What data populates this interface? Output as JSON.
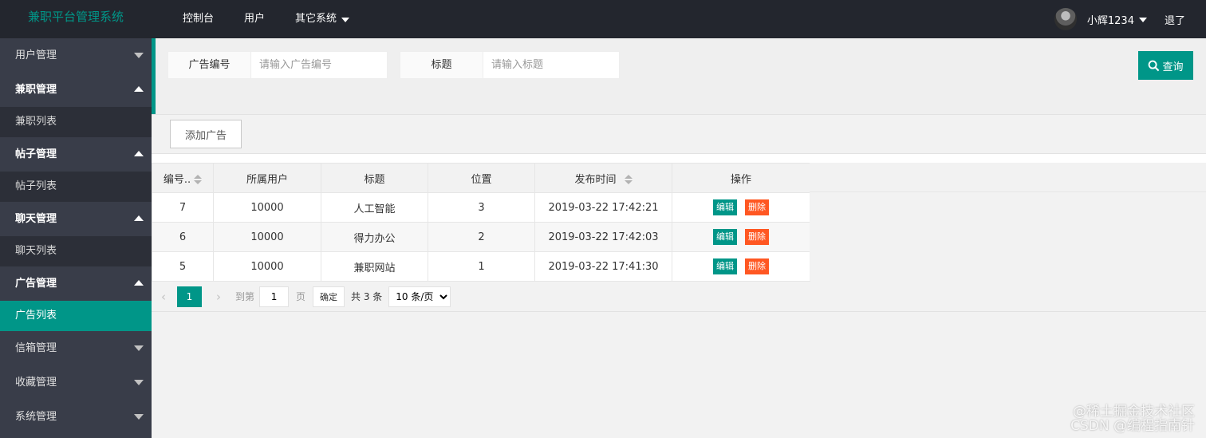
{
  "header": {
    "logo": "兼职平台管理系统",
    "nav": [
      {
        "label": "控制台"
      },
      {
        "label": "用户"
      },
      {
        "label": "其它系统"
      }
    ],
    "user_name": "小辉1234",
    "logout": "退了"
  },
  "sidebar": {
    "items": [
      {
        "label": "用户管理",
        "type": "group",
        "open": false
      },
      {
        "label": "兼职管理",
        "type": "group",
        "open": true
      },
      {
        "label": "兼职列表",
        "type": "sub",
        "active": false
      },
      {
        "label": "帖子管理",
        "type": "group",
        "open": true
      },
      {
        "label": "帖子列表",
        "type": "sub",
        "active": false
      },
      {
        "label": "聊天管理",
        "type": "group",
        "open": true
      },
      {
        "label": "聊天列表",
        "type": "sub",
        "active": false
      },
      {
        "label": "广告管理",
        "type": "group",
        "open": true
      },
      {
        "label": "广告列表",
        "type": "sub",
        "active": true
      },
      {
        "label": "信箱管理",
        "type": "group",
        "open": false
      },
      {
        "label": "收藏管理",
        "type": "group",
        "open": false
      },
      {
        "label": "系统管理",
        "type": "group",
        "open": false
      }
    ]
  },
  "search": {
    "ad_id_label": "广告编号",
    "ad_id_placeholder": "请输入广告编号",
    "title_label": "标题",
    "title_placeholder": "请输入标题",
    "search_button": "查询"
  },
  "toolbar": {
    "add_button": "添加广告"
  },
  "table": {
    "columns": [
      "编号..",
      "所属用户",
      "标题",
      "位置",
      "发布时间",
      "操作"
    ],
    "rows": [
      {
        "id": "7",
        "user": "10000",
        "title": "人工智能",
        "position": "3",
        "time": "2019-03-22 17:42:21"
      },
      {
        "id": "6",
        "user": "10000",
        "title": "得力办公",
        "position": "2",
        "time": "2019-03-22 17:42:03"
      },
      {
        "id": "5",
        "user": "10000",
        "title": "兼职网站",
        "position": "1",
        "time": "2019-03-22 17:41:30"
      }
    ],
    "edit_label": "编辑",
    "delete_label": "删除"
  },
  "pager": {
    "prev": "‹",
    "current": "1",
    "next": "›",
    "goto_label": "到第",
    "goto_value": "1",
    "page_label": "页",
    "confirm": "确定",
    "total": "共 3 条",
    "page_size": "10 条/页"
  },
  "watermark": {
    "line1": "@稀土掘金技术社区",
    "line2": "CSDN @编程指南针"
  },
  "colors": {
    "header_bg": "#23262e",
    "sidebar_bg": "#393d49",
    "accent": "#009688",
    "danger": "#ff5722"
  }
}
